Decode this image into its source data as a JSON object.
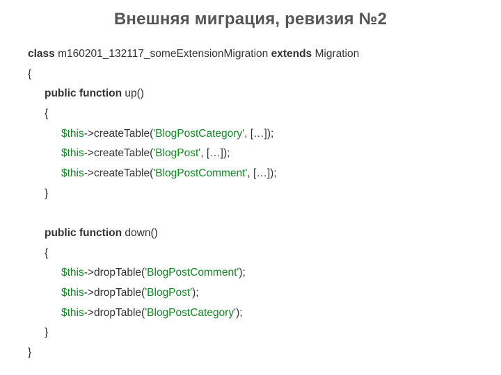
{
  "title": "Внешняя миграция, ревизия №2",
  "kw": {
    "class": "class",
    "extends": "extends",
    "publicFunction": "public function"
  },
  "className": " m160201_132117_someExtensionMigration ",
  "baseClass": " Migration",
  "openBrace": "{",
  "closeBrace": "}",
  "up": {
    "name": " up()",
    "open": "{",
    "close": "}",
    "lines": [
      {
        "this": "$this",
        "call1": "->createTable(",
        "str": "'BlogPostCategory'",
        "call2": ", […]);"
      },
      {
        "this": "$this",
        "call1": "->createTable(",
        "str": "'BlogPost'",
        "call2": ", […]);"
      },
      {
        "this": "$this",
        "call1": "->createTable(",
        "str": "'BlogPostComment'",
        "call2": ", […]);"
      }
    ]
  },
  "down": {
    "name": " down()",
    "open": "{",
    "close": "}",
    "lines": [
      {
        "this": "$this",
        "call1": "->dropTable(",
        "str": "'BlogPostComment'",
        "call2": ");"
      },
      {
        "this": "$this",
        "call1": "->dropTable(",
        "str": "'BlogPost'",
        "call2": ");"
      },
      {
        "this": "$this",
        "call1": "->dropTable(",
        "str": "'BlogPostCategory'",
        "call2": ");"
      }
    ]
  }
}
